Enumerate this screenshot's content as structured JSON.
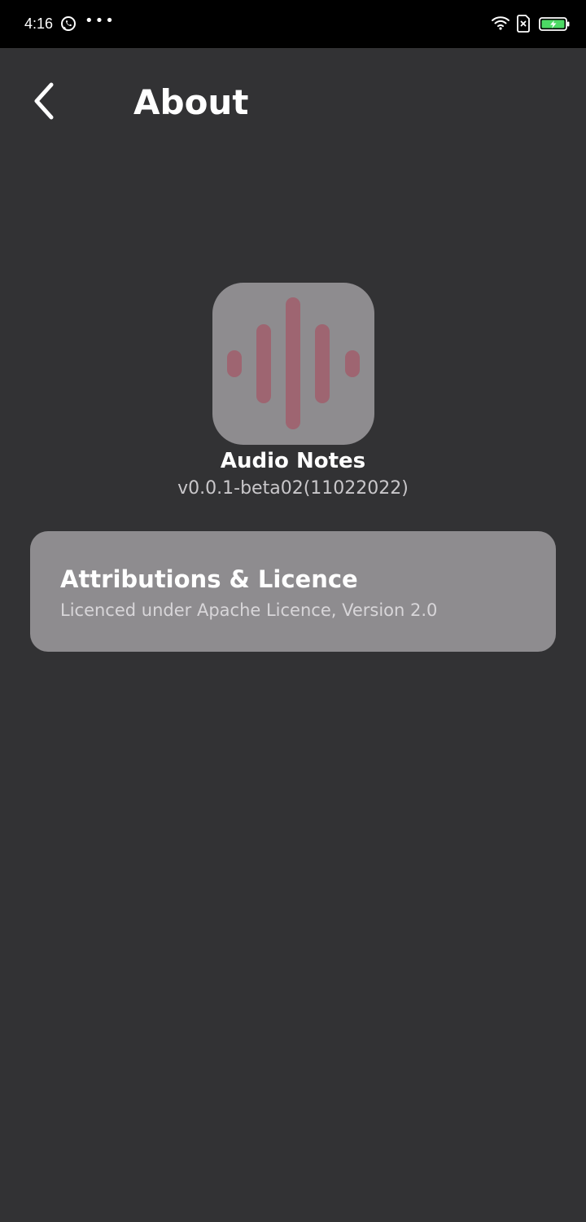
{
  "status_bar": {
    "time": "4:16",
    "more": "•••",
    "icons": [
      "whatsapp-icon",
      "wifi-icon",
      "sim-icon",
      "battery-charging-icon"
    ]
  },
  "header": {
    "back_icon": "chevron-left-icon",
    "title": "About"
  },
  "app": {
    "icon": "audio-waveform-icon",
    "name": "Audio Notes",
    "version": "v0.0.1-beta02(11022022)"
  },
  "licence_card": {
    "title": "Attributions & Licence",
    "subtitle": "Licenced under Apache Licence, Version 2.0"
  },
  "colors": {
    "background": "#323234",
    "status_bar": "#000000",
    "card": "#8e8c8f",
    "icon_accent": "#9e6571",
    "battery_accent": "#4cd964"
  }
}
